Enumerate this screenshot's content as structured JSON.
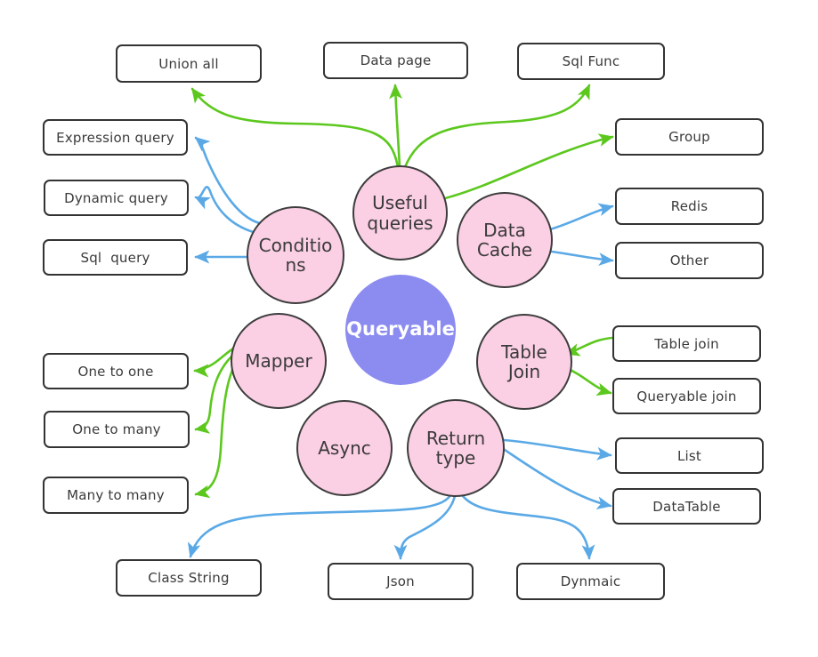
{
  "diagram": {
    "title": "Queryable",
    "type": "mind-map",
    "colors": {
      "center_fill": "#8c8cf0",
      "center_text": "#ffffff",
      "branch_fill": "#fbcfe4",
      "branch_stroke": "#3d3d3d",
      "leaf_fill": "#ffffff",
      "leaf_stroke": "#333333",
      "edge_green": "#5cc81e",
      "edge_blue": "#5aa9e6",
      "background": "#ffffff"
    },
    "center": {
      "label": "Queryable"
    },
    "branches": [
      {
        "id": "useful-queries",
        "label": "Useful\nqueries",
        "edge_color": "#5cc81e"
      },
      {
        "id": "conditions",
        "label": "Conditio\nns",
        "edge_color": "#5aa9e6"
      },
      {
        "id": "data-cache",
        "label": "Data\nCache",
        "edge_color": "#5aa9e6"
      },
      {
        "id": "mapper",
        "label": "Mapper",
        "edge_color": "#5cc81e"
      },
      {
        "id": "table-join",
        "label": "Table\nJoin",
        "edge_color": "#5cc81e"
      },
      {
        "id": "async",
        "label": "Async",
        "edge_color": "#5aa9e6"
      },
      {
        "id": "return-type",
        "label": "Return\ntype",
        "edge_color": "#5aa9e6"
      }
    ],
    "leaves": [
      {
        "id": "union-all",
        "label": "Union all",
        "parent": "useful-queries",
        "edge_color": "#5cc81e"
      },
      {
        "id": "data-page",
        "label": "Data page",
        "parent": "useful-queries",
        "edge_color": "#5cc81e"
      },
      {
        "id": "sql-func",
        "label": "Sql Func",
        "parent": "useful-queries",
        "edge_color": "#5cc81e"
      },
      {
        "id": "group",
        "label": "Group",
        "parent": "useful-queries",
        "edge_color": "#5cc81e"
      },
      {
        "id": "expression-query",
        "label": "Expression query",
        "parent": "conditions",
        "edge_color": "#5aa9e6"
      },
      {
        "id": "dynamic-query",
        "label": "Dynamic query",
        "parent": "conditions",
        "edge_color": "#5aa9e6"
      },
      {
        "id": "sql-query",
        "label": "Sql  query",
        "parent": "conditions",
        "edge_color": "#5aa9e6"
      },
      {
        "id": "redis",
        "label": "Redis",
        "parent": "data-cache",
        "edge_color": "#5aa9e6"
      },
      {
        "id": "other",
        "label": "Other",
        "parent": "data-cache",
        "edge_color": "#5aa9e6"
      },
      {
        "id": "one-to-one",
        "label": "One to one",
        "parent": "mapper",
        "edge_color": "#5cc81e"
      },
      {
        "id": "one-to-many",
        "label": "One to many",
        "parent": "mapper",
        "edge_color": "#5cc81e"
      },
      {
        "id": "many-to-many",
        "label": "Many to many",
        "parent": "mapper",
        "edge_color": "#5cc81e"
      },
      {
        "id": "table-join-leaf",
        "label": "Table join",
        "parent": "table-join",
        "edge_color": "#5cc81e"
      },
      {
        "id": "queryable-join",
        "label": "Queryable join",
        "parent": "table-join",
        "edge_color": "#5cc81e"
      },
      {
        "id": "list",
        "label": "List",
        "parent": "return-type",
        "edge_color": "#5aa9e6"
      },
      {
        "id": "datatable",
        "label": "DataTable",
        "parent": "return-type",
        "edge_color": "#5aa9e6"
      },
      {
        "id": "class-string",
        "label": "Class String",
        "parent": "return-type",
        "edge_color": "#5aa9e6"
      },
      {
        "id": "json",
        "label": "Json",
        "parent": "return-type",
        "edge_color": "#5aa9e6"
      },
      {
        "id": "dynmaic",
        "label": "Dynmaic",
        "parent": "return-type",
        "edge_color": "#5aa9e6"
      }
    ]
  }
}
